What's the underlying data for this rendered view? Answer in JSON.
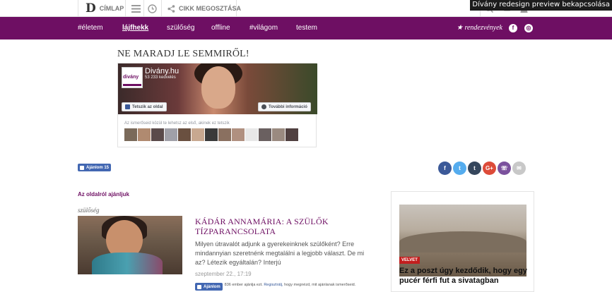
{
  "topbar": {
    "logo_letter": "D",
    "home_label": "CÍMLAP",
    "share_label": "CIKK MEGOSZTÁSA",
    "preview_label": "Dívány redesign preview bekapcsolása"
  },
  "nav": {
    "items": [
      {
        "label": "#életem",
        "active": false
      },
      {
        "label": "lájfhekk",
        "active": true
      },
      {
        "label": "szülőség",
        "active": false
      },
      {
        "label": "offline",
        "active": false
      },
      {
        "label": "#világom",
        "active": false
      },
      {
        "label": "testem",
        "active": false
      }
    ],
    "events_label": "★ rendezvények",
    "facebook_icon": "f",
    "instagram_icon": "◎"
  },
  "headline": "NE MARADJ LE SEMMIRŐL!",
  "fbpage": {
    "avatar_text": "divány",
    "name": "Divány.hu",
    "likes": "53 233 kedvelés",
    "like_page_label": "Tetszik az oldal",
    "more_info_label": "További információ",
    "friends_text": "Az ismerőseid közül te lehetsz az első, akinek ez tetszik"
  },
  "like_button": {
    "label": "Ajánlom 15"
  },
  "share": {
    "icons": [
      {
        "name": "facebook",
        "glyph": "f",
        "color": "#3b5998"
      },
      {
        "name": "twitter",
        "glyph": "t",
        "color": "#55acee"
      },
      {
        "name": "tumblr",
        "glyph": "t",
        "color": "#35465c"
      },
      {
        "name": "googleplus",
        "glyph": "G+",
        "color": "#dd4b39"
      },
      {
        "name": "viber",
        "glyph": "☏",
        "color": "#7b519d"
      },
      {
        "name": "email",
        "glyph": "✉",
        "color": "#c8c8c8"
      }
    ]
  },
  "recommend": {
    "section_title": "Az oldalról ajánljuk",
    "category": "szülőség",
    "title": "KÁDÁR ANNAMÁRIA: A SZÜLŐK TÍZPARANCSOLATA",
    "lead": "Milyen útravalót adjunk a gyerekeinknek szülőként? Erre mindannyian szeretnénk megtalálni a legjobb választ. De mi az? Létezik egyáltalán? Interjú",
    "date": "szeptember 22., 17:19",
    "fb_label": "Ajánlom",
    "fb_text_start": "836 ember ajánlja ezt.",
    "fb_link": "Regisztrálj,",
    "fb_text_end": "hogy megnézd, mit ajánlanak ismerőseid."
  },
  "sidebar": {
    "badge": "VELVET",
    "title": "Ez a poszt úgy kezdődik, hogy egy pucér férfi fut a sivatagban"
  },
  "colors": {
    "brand_purple": "#6e0f63",
    "fb_blue": "#4267b2"
  }
}
